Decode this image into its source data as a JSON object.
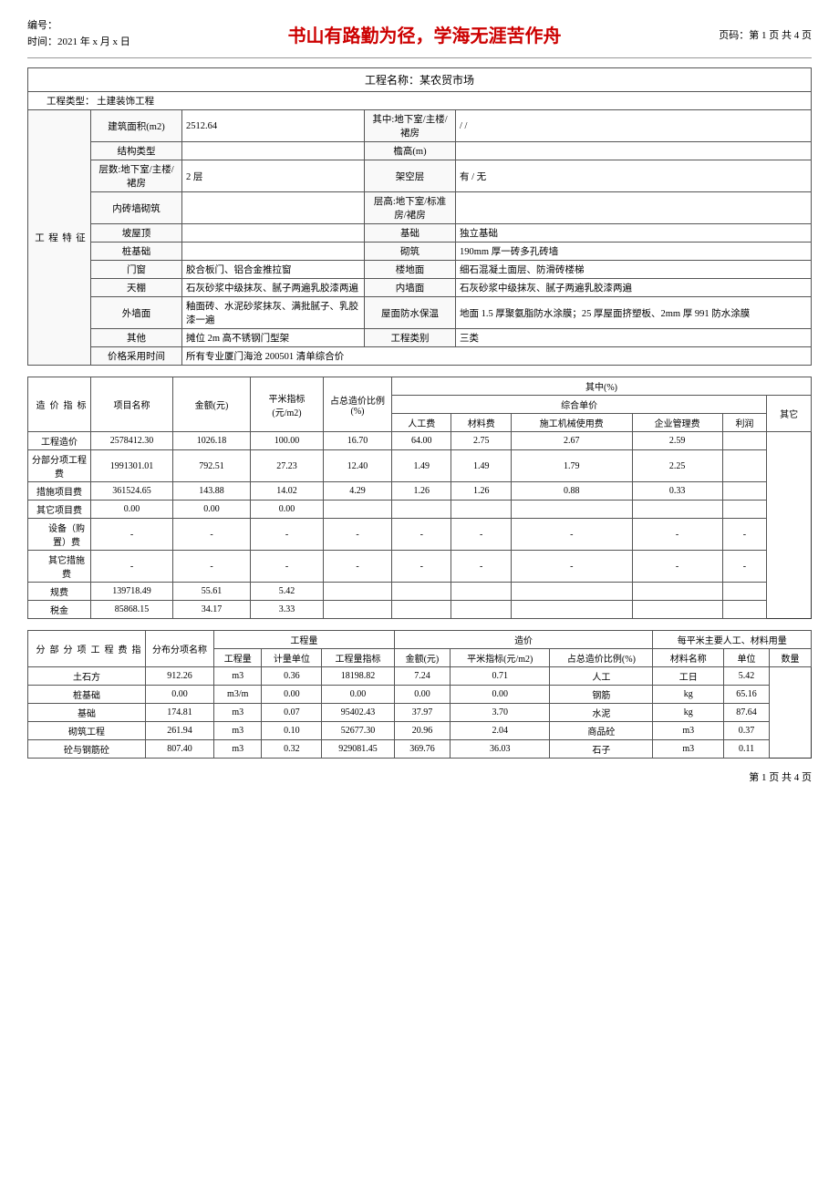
{
  "header": {
    "biaohao_label": "编号：",
    "time_label": "时间：2021 年 x 月 x 日",
    "slogan": "书山有路勤为径，学海无涯苦作舟",
    "page_info": "页码：第 1 页  共 4 页"
  },
  "project": {
    "title_label": "工程名称：某农贸市场",
    "type_label": "工程类型：   土建装饰工程"
  },
  "features": {
    "section_title": "工程特征",
    "rows": [
      {
        "label": "建筑面积(m2)",
        "value": "2512.64",
        "right_label": "其中:地下室/主楼/裙房",
        "right_value": "/ /"
      },
      {
        "label": "结构类型",
        "value": "",
        "right_label": "檐高(m)",
        "right_value": ""
      },
      {
        "label": "层数:地下室/主楼/裙房",
        "value": "2 层",
        "right_label": "架空层",
        "right_value": "有 / 无"
      },
      {
        "label": "内砖墙砌筑",
        "value": "",
        "right_label": "层高:地下室/标准房/裙房",
        "right_value": ""
      },
      {
        "label": "坡屋顶",
        "value": "",
        "right_label": "基础",
        "right_value": "独立基础"
      },
      {
        "label": "桩基础",
        "value": "",
        "right_label": "砌筑",
        "right_value": "190mm 厚一砖多孔砖墙"
      },
      {
        "label": "门窗",
        "value": "胶合板门、铝合金推拉窗",
        "right_label": "楼地面",
        "right_value": "细石混凝土面层、防滑砖楼梯"
      },
      {
        "label": "天棚",
        "value": "石灰砂浆中级抹灰、腻子两遍乳胶漆两遍",
        "right_label": "内墙面",
        "right_value": "石灰砂浆中级抹灰、腻子两遍乳胶漆两遍"
      },
      {
        "label": "外墙面",
        "value": "釉面砖、水泥砂浆抹灰、满批腻子、乳胶漆一遍",
        "right_label": "屋面防水保温",
        "right_value": "地面 1.5 厚聚氨脂防水涂膜；25 厚屋面挤塑板、2mm 厚 991 防水涂膜"
      },
      {
        "label": "其他",
        "value": "摊位 2m 高不锈钢门型架",
        "right_label": "工程类别",
        "right_value": "三类"
      },
      {
        "label": "价格采用时间",
        "value": "所有专业厦门海沧 200501 清单综合价",
        "right_label": "",
        "right_value": ""
      }
    ]
  },
  "cost_index": {
    "section_title": "造价指标",
    "sub_title": "其中",
    "headers": {
      "col1": "项目名称",
      "col2": "金额(元)",
      "col3": "平米指标(元/m2)",
      "col4": "占总造价比例(%)",
      "group": "其中(%)",
      "sub_group": "综合单价",
      "h1": "人工费",
      "h2": "材料费",
      "h3": "施工机械使用费",
      "h4": "企业管理费",
      "h5": "利润",
      "h6": "其它"
    },
    "rows": [
      {
        "name": "工程造价",
        "amount": "2578412.30",
        "per_sqm": "1026.18",
        "ratio": "100.00",
        "labor": "16.70",
        "material": "64.00",
        "machine": "2.75",
        "mgmt": "2.67",
        "profit": "2.59",
        "other": ""
      },
      {
        "name": "分部分项工程费",
        "amount": "1991301.01",
        "per_sqm": "792.51",
        "ratio": "27.23",
        "labor": "12.40",
        "material": "1.49",
        "machine": "1.49",
        "mgmt": "1.79",
        "profit": "2.25",
        "other": ""
      },
      {
        "name": "措施项目费",
        "amount": "361524.65",
        "per_sqm": "143.88",
        "ratio": "14.02",
        "labor": "4.29",
        "material": "1.26",
        "machine": "1.26",
        "mgmt": "0.88",
        "profit": "0.33",
        "other": ""
      },
      {
        "name": "其它项目费",
        "amount": "0.00",
        "per_sqm": "0.00",
        "ratio": "0.00",
        "labor": "",
        "material": "",
        "machine": "",
        "mgmt": "",
        "profit": "",
        "other": ""
      },
      {
        "name": "设备（购置）费",
        "amount": "-",
        "per_sqm": "-",
        "ratio": "-",
        "labor": "-",
        "material": "-",
        "machine": "-",
        "mgmt": "-",
        "profit": "-",
        "other": "-"
      },
      {
        "name": "其它措施费",
        "amount": "-",
        "per_sqm": "-",
        "ratio": "-",
        "labor": "-",
        "material": "-",
        "machine": "-",
        "mgmt": "-",
        "profit": "-",
        "other": "-"
      },
      {
        "name": "规费",
        "amount": "139718.49",
        "per_sqm": "55.61",
        "ratio": "5.42",
        "labor": "",
        "material": "",
        "machine": "",
        "mgmt": "",
        "profit": "",
        "other": ""
      },
      {
        "name": "税金",
        "amount": "85868.15",
        "per_sqm": "34.17",
        "ratio": "3.33",
        "labor": "",
        "material": "",
        "machine": "",
        "mgmt": "",
        "profit": "",
        "other": ""
      }
    ]
  },
  "division": {
    "section_title": "分部分项工程费指",
    "headers": {
      "name": "分布分项名称",
      "eng_qty": "工程量",
      "unit": "计量单位",
      "qty_index": "工程量指标",
      "amount": "金额(元)",
      "per_sqm": "平米指标(元/m2)",
      "ratio": "占总造价比例(%)",
      "mat_name": "材料名称",
      "mat_unit": "单位",
      "mat_qty": "数量",
      "eng_qty_header": "工程量",
      "cost_header": "造价",
      "per_sqm_mat": "每平米主要人工、材料用量"
    },
    "rows": [
      {
        "name": "土石方",
        "qty": "912.26",
        "unit": "m3",
        "qty_index": "0.36",
        "amount": "18198.82",
        "per_sqm": "7.24",
        "ratio": "0.71",
        "mat_name": "人工",
        "mat_unit": "工日",
        "mat_qty": "5.42"
      },
      {
        "name": "桩基础",
        "qty": "0.00",
        "unit": "m3/m",
        "qty_index": "0.00",
        "amount": "0.00",
        "per_sqm": "0.00",
        "ratio": "0.00",
        "mat_name": "钢筋",
        "mat_unit": "kg",
        "mat_qty": "65.16"
      },
      {
        "name": "基础",
        "qty": "174.81",
        "unit": "m3",
        "qty_index": "0.07",
        "amount": "95402.43",
        "per_sqm": "37.97",
        "ratio": "3.70",
        "mat_name": "水泥",
        "mat_unit": "kg",
        "mat_qty": "87.64"
      },
      {
        "name": "砌筑工程",
        "qty": "261.94",
        "unit": "m3",
        "qty_index": "0.10",
        "amount": "52677.30",
        "per_sqm": "20.96",
        "ratio": "2.04",
        "mat_name": "商品砼",
        "mat_unit": "m3",
        "mat_qty": "0.37"
      },
      {
        "name": "砼与钢筋砼",
        "qty": "807.40",
        "unit": "m3",
        "qty_index": "0.32",
        "amount": "929081.45",
        "per_sqm": "369.76",
        "ratio": "36.03",
        "mat_name": "石子",
        "mat_unit": "m3",
        "mat_qty": "0.11"
      }
    ]
  },
  "footer": {
    "text": "第 1 页  共 4 页"
  }
}
